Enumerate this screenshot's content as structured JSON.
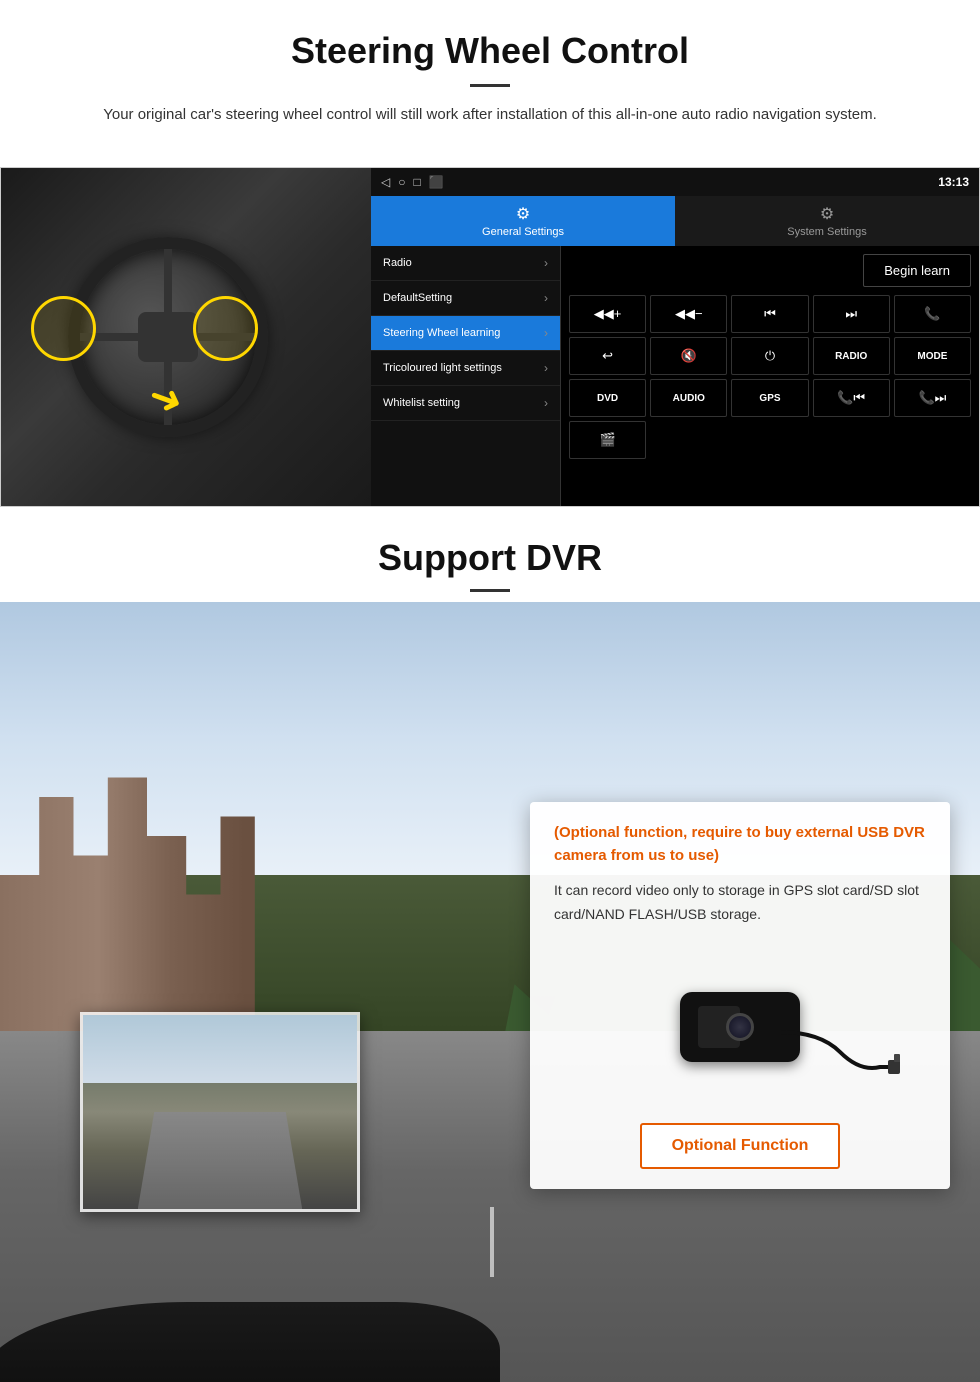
{
  "page": {
    "section1": {
      "title": "Steering Wheel Control",
      "subtitle": "Your original car's steering wheel control will still work after installation of this all-in-one auto radio navigation system.",
      "divider": true
    },
    "android_ui": {
      "topbar": {
        "time": "13:13",
        "icons": [
          "◁",
          "○",
          "□",
          "⬛",
          "♦"
        ]
      },
      "tabs": [
        {
          "id": "general",
          "label": "General Settings",
          "icon": "⚙",
          "active": true
        },
        {
          "id": "system",
          "label": "System Settings",
          "icon": "🔧",
          "active": false
        }
      ],
      "menu_items": [
        {
          "id": "radio",
          "label": "Radio",
          "active": false
        },
        {
          "id": "default",
          "label": "DefaultSetting",
          "active": false
        },
        {
          "id": "sw_learning",
          "label": "Steering Wheel learning",
          "active": true
        },
        {
          "id": "tricolour",
          "label": "Tricoloured light settings",
          "active": false
        },
        {
          "id": "whitelist",
          "label": "Whitelist setting",
          "active": false
        }
      ],
      "begin_learn": "Begin learn",
      "control_buttons": [
        {
          "label": "◀◀+",
          "row": 1,
          "col": 1
        },
        {
          "label": "◀◀−",
          "row": 1,
          "col": 2
        },
        {
          "label": "◀◀",
          "row": 1,
          "col": 3
        },
        {
          "label": "▶▶",
          "row": 1,
          "col": 4
        },
        {
          "label": "📞",
          "row": 1,
          "col": 5
        },
        {
          "label": "↩",
          "row": 2,
          "col": 1
        },
        {
          "label": "🔇",
          "row": 2,
          "col": 2
        },
        {
          "label": "⏻",
          "row": 2,
          "col": 3
        },
        {
          "label": "RADIO",
          "row": 2,
          "col": 4
        },
        {
          "label": "MODE",
          "row": 2,
          "col": 5
        },
        {
          "label": "DVD",
          "row": 3,
          "col": 1
        },
        {
          "label": "AUDIO",
          "row": 3,
          "col": 2
        },
        {
          "label": "GPS",
          "row": 3,
          "col": 3
        },
        {
          "label": "📞◀◀",
          "row": 3,
          "col": 4
        },
        {
          "label": "⏭📞",
          "row": 3,
          "col": 5
        },
        {
          "label": "🎬",
          "row": 4,
          "col": 1
        }
      ]
    },
    "section2": {
      "title": "Support DVR",
      "divider": true,
      "info_card": {
        "optional_text": "(Optional function, require to buy external USB DVR camera from us to use)",
        "description": "It can record video only to storage in GPS slot card/SD slot card/NAND FLASH/USB storage.",
        "optional_function_label": "Optional Function"
      }
    }
  }
}
